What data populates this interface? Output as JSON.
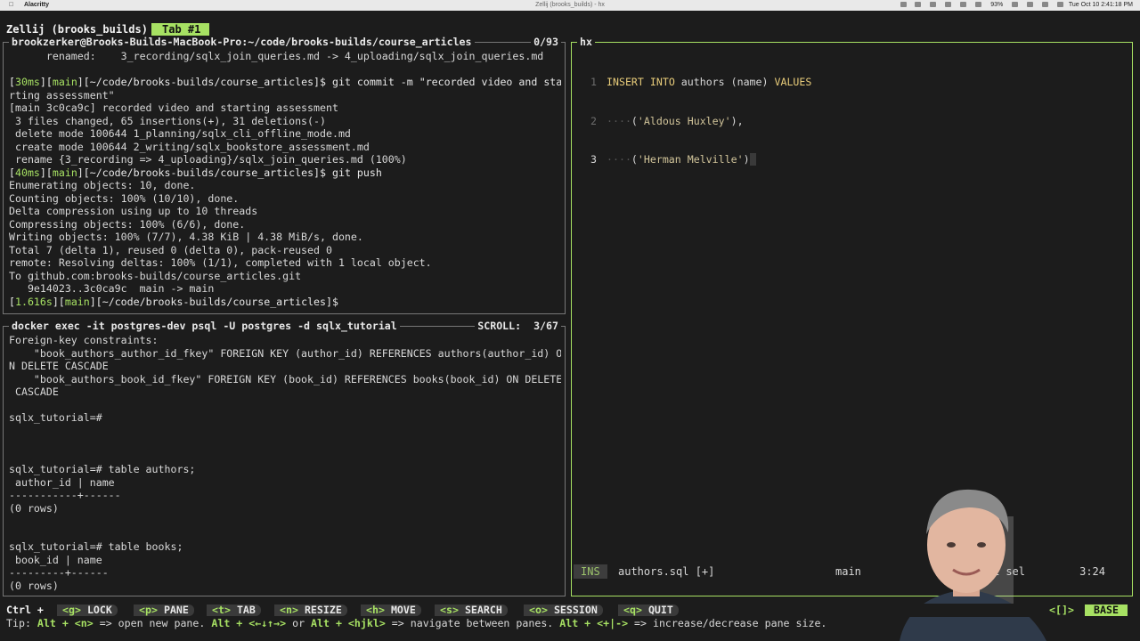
{
  "menubar": {
    "app_name": "Alacritty",
    "window_title": "Zellij (brooks_builds) - hx",
    "battery": "93%",
    "clock": "Tue Oct 10  2:41:18 PM"
  },
  "tabbar": {
    "session": "Zellij (brooks_builds)",
    "tab_label": "Tab #1"
  },
  "git_pane": {
    "title": "brookzerker@Brooks-Builds-MacBook-Pro:~/code/brooks-builds/course_articles",
    "scroll": "0/93",
    "lines": [
      "      renamed:    3_recording/sqlx_join_queries.md -> 4_uploading/sqlx_join_queries.md",
      "",
      "[30ms][main][~/code/brooks-builds/course_articles]$ git commit -m \"recorded video and sta",
      "rting assessment\"",
      "[main 3c0ca9c] recorded video and starting assessment",
      " 3 files changed, 65 insertions(+), 31 deletions(-)",
      " delete mode 100644 1_planning/sqlx_cli_offline_mode.md",
      " create mode 100644 2_writing/sqlx_bookstore_assessment.md",
      " rename {3_recording => 4_uploading}/sqlx_join_queries.md (100%)",
      "[40ms][main][~/code/brooks-builds/course_articles]$ git push",
      "Enumerating objects: 10, done.",
      "Counting objects: 100% (10/10), done.",
      "Delta compression using up to 10 threads",
      "Compressing objects: 100% (6/6), done.",
      "Writing objects: 100% (7/7), 4.38 KiB | 4.38 MiB/s, done.",
      "Total 7 (delta 1), reused 0 (delta 0), pack-reused 0",
      "remote: Resolving deltas: 100% (1/1), completed with 1 local object.",
      "To github.com:brooks-builds/course_articles.git",
      "   9e14023..3c0ca9c  main -> main",
      "[1.616s][main][~/code/brooks-builds/course_articles]$"
    ]
  },
  "psql_pane": {
    "title": "docker exec -it postgres-dev psql -U postgres -d sqlx_tutorial",
    "scroll": "SCROLL:  3/67",
    "lines": [
      "Foreign-key constraints:",
      "    \"book_authors_author_id_fkey\" FOREIGN KEY (author_id) REFERENCES authors(author_id) O",
      "N DELETE CASCADE",
      "    \"book_authors_book_id_fkey\" FOREIGN KEY (book_id) REFERENCES books(book_id) ON DELETE",
      " CASCADE",
      "",
      "sqlx_tutorial=#",
      "",
      "",
      "",
      "sqlx_tutorial=# table authors;",
      " author_id | name",
      "-----------+------",
      "(0 rows)",
      "",
      "",
      "sqlx_tutorial=# table books;",
      " book_id | name",
      "---------+------",
      "(0 rows)"
    ]
  },
  "editor": {
    "title": "hx",
    "lines": [
      {
        "num": "1",
        "text": "INSERT INTO authors (name) VALUES"
      },
      {
        "num": "2",
        "text": "    ('Aldous Huxley'),"
      },
      {
        "num": "3",
        "text": "    ('Herman Melville')"
      }
    ],
    "status": {
      "mode": "INS",
      "file": "authors.sql [+]",
      "branch": "main",
      "selections": "1 sel",
      "position": "3:24"
    }
  },
  "keybar": {
    "prefix": "Ctrl +",
    "items": [
      {
        "key": "<g>",
        "label": "LOCK"
      },
      {
        "key": "<p>",
        "label": "PANE"
      },
      {
        "key": "<t>",
        "label": "TAB"
      },
      {
        "key": "<n>",
        "label": "RESIZE"
      },
      {
        "key": "<h>",
        "label": "MOVE"
      },
      {
        "key": "<s>",
        "label": "SEARCH"
      },
      {
        "key": "<o>",
        "label": "SESSION"
      },
      {
        "key": "<q>",
        "label": "QUIT"
      }
    ],
    "layout_indicator": "<[]>",
    "mode": "BASE"
  },
  "tip": {
    "prefix": "Tip: ",
    "k1": "Alt + <n>",
    "t1": " => open new pane. ",
    "k2": "Alt + <←↓↑→>",
    "t2": " or ",
    "k3": "Alt + <hjkl>",
    "t3": " => navigate between panes. ",
    "k4": "Alt + <+|->",
    "t4": " => increase/decrease pane size."
  },
  "colors": {
    "accent": "#a7e163",
    "background": "#1c1c1c",
    "inactive_border": "#777777"
  }
}
